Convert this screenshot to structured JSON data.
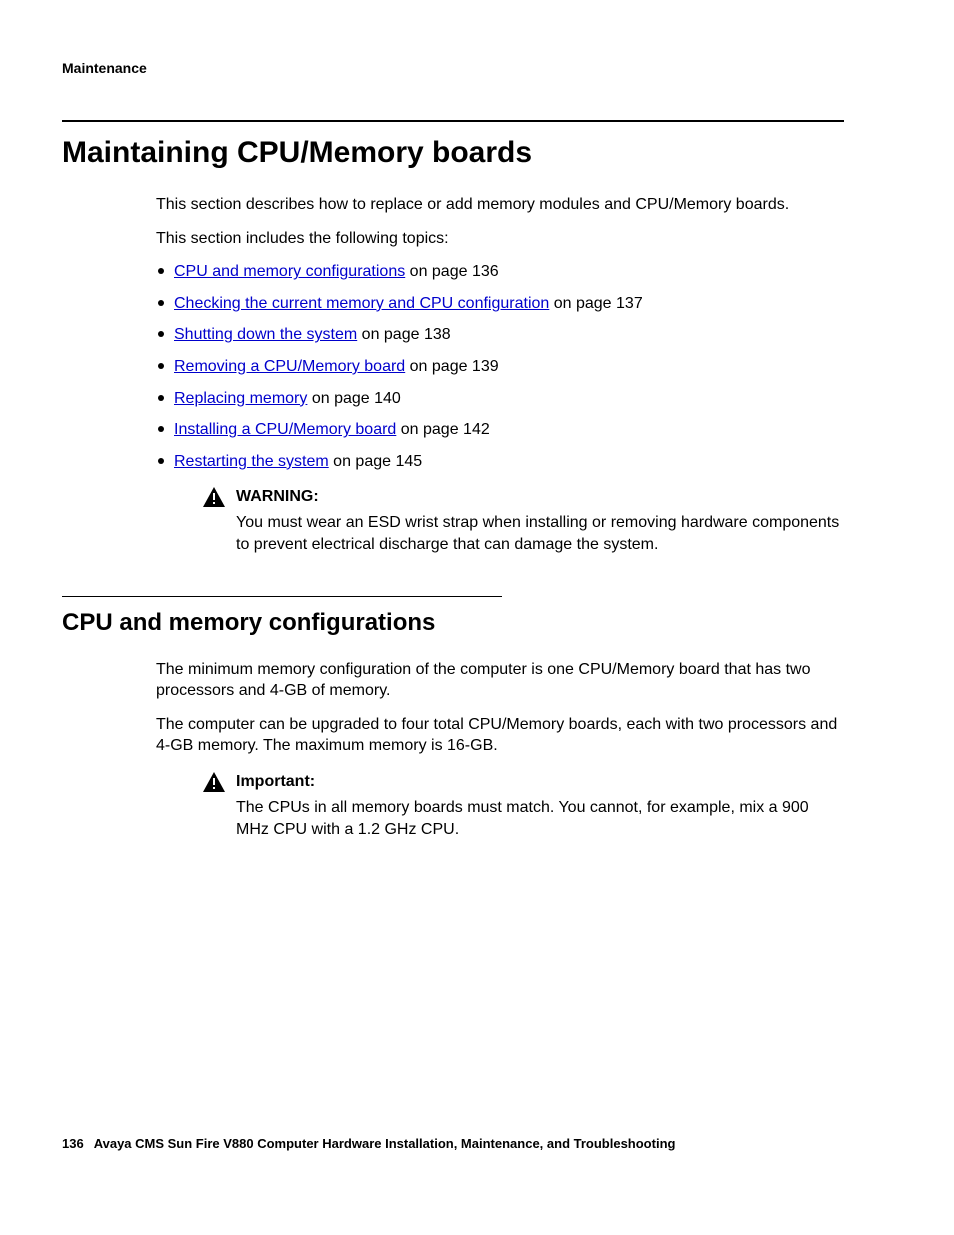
{
  "header": "Maintenance",
  "title": "Maintaining CPU/Memory boards",
  "intro1": "This section describes how to replace or add memory modules and CPU/Memory boards.",
  "intro2": "This section includes the following topics:",
  "toc": [
    {
      "link": "CPU and memory configurations",
      "rest": " on page 136"
    },
    {
      "link": "Checking the current memory and CPU configuration",
      "rest": " on page 137"
    },
    {
      "link": "Shutting down the system",
      "rest": " on page 138"
    },
    {
      "link": "Removing a CPU/Memory board",
      "rest": " on page 139"
    },
    {
      "link": "Replacing memory",
      "rest": " on page 140"
    },
    {
      "link": "Installing a CPU/Memory board",
      "rest": " on page 142"
    },
    {
      "link": "Restarting the system",
      "rest": " on page 145"
    }
  ],
  "warning": {
    "label": "WARNING:",
    "body": "You must wear an ESD wrist strap when installing or removing hardware components to prevent electrical discharge that can damage the system."
  },
  "section2": {
    "title": "CPU and memory configurations",
    "p1": "The minimum memory configuration of the computer is one CPU/Memory board that has two processors and 4-GB of memory.",
    "p2": "The computer can be upgraded to four total CPU/Memory boards, each with two processors and 4-GB memory. The maximum memory is 16-GB."
  },
  "important": {
    "label": "Important:",
    "body": "The CPUs in all memory boards must match. You cannot, for example, mix a 900 MHz CPU with a 1.2 GHz CPU."
  },
  "footer": {
    "page": "136",
    "text": "Avaya CMS Sun Fire V880 Computer Hardware Installation, Maintenance, and Troubleshooting"
  }
}
